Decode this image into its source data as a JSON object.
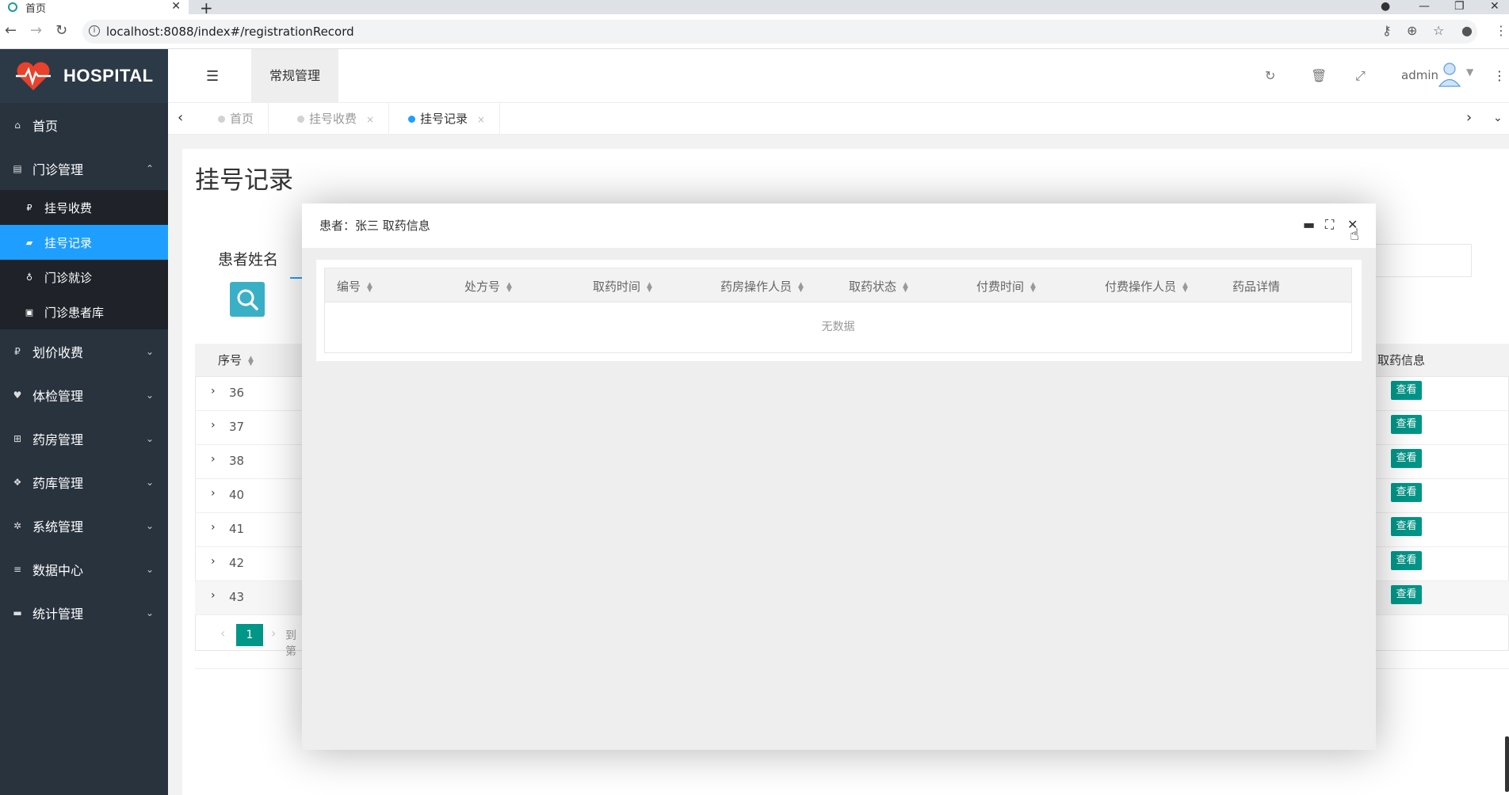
{
  "browser": {
    "tab_title": "首页",
    "tab_close": "✕",
    "new_tab": "+",
    "url": "localhost:8088/index#/registrationRecord"
  },
  "sidebar": {
    "logo_text": "HOSPITAL",
    "items": [
      {
        "label": "首页",
        "icon": "home-icon",
        "glyph": "⌂"
      },
      {
        "label": "门诊管理",
        "icon": "clipboard-icon",
        "glyph": "▤",
        "chevron": "⌃"
      },
      {
        "label": "划价收费",
        "icon": "money-icon",
        "glyph": "₽",
        "chevron": "⌄"
      },
      {
        "label": "体检管理",
        "icon": "heartbeat-icon",
        "glyph": "♥",
        "chevron": "⌄"
      },
      {
        "label": "药房管理",
        "icon": "plus-square-icon",
        "glyph": "⊞",
        "chevron": "⌄"
      },
      {
        "label": "药库管理",
        "icon": "cubes-icon",
        "glyph": "❖",
        "chevron": "⌄"
      },
      {
        "label": "系统管理",
        "icon": "gear-icon",
        "glyph": "✲",
        "chevron": "⌄"
      },
      {
        "label": "数据中心",
        "icon": "database-icon",
        "glyph": "≡",
        "chevron": "⌄"
      },
      {
        "label": "统计管理",
        "icon": "comment-icon",
        "glyph": "▬",
        "chevron": "⌄"
      }
    ],
    "submenu": [
      {
        "label": "挂号收费",
        "glyph": "₽"
      },
      {
        "label": "挂号记录",
        "glyph": "▰"
      },
      {
        "label": "门诊就诊",
        "glyph": "♁"
      },
      {
        "label": "门诊患者库",
        "glyph": "▣"
      }
    ]
  },
  "header": {
    "tab": "常规管理",
    "user": "admin"
  },
  "page_tabs": [
    {
      "label": "首页"
    },
    {
      "label": "挂号收费",
      "close": "×"
    },
    {
      "label": "挂号记录",
      "close": "×"
    }
  ],
  "content": {
    "title": "挂号记录",
    "search_label": "患者姓名",
    "col_seq": "序号",
    "col_info": "取药信息",
    "view_label": "查看",
    "rows": [
      "36",
      "37",
      "38",
      "40",
      "41",
      "42",
      "43"
    ],
    "current_page": "1",
    "goto": "到第"
  },
  "modal": {
    "title": "患者：张三 取药信息",
    "columns": [
      "编号",
      "处方号",
      "取药时间",
      "药房操作人员",
      "取药状态",
      "付费时间",
      "付费操作人员",
      "药品详情"
    ],
    "empty": "无数据"
  },
  "colors": {
    "accent": "#1e9fff",
    "teal": "#009688",
    "sidebar_bg": "#28333e"
  }
}
